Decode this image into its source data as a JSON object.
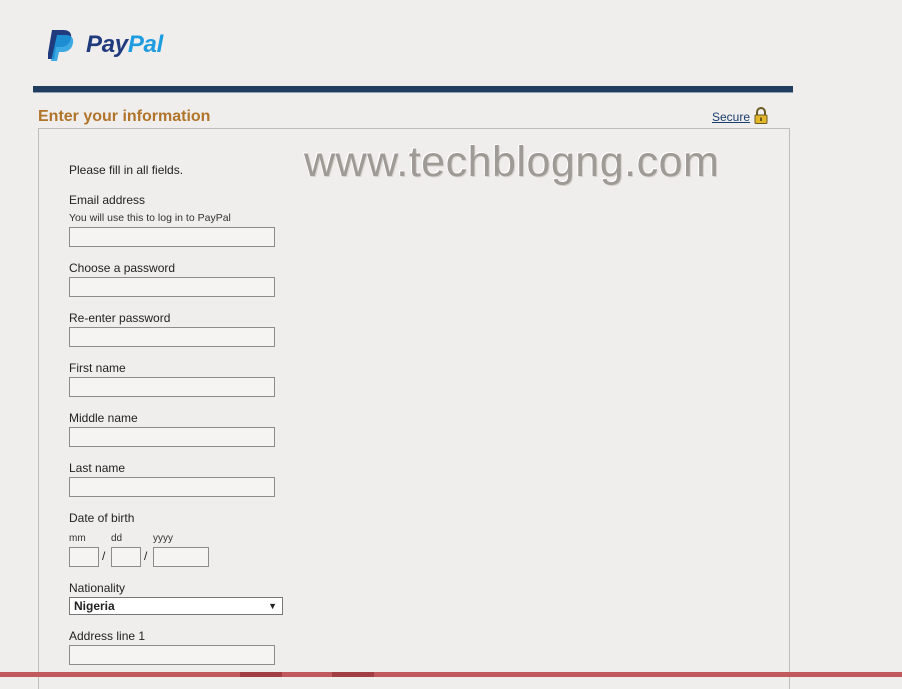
{
  "brand": {
    "logo_pay": "Pay",
    "logo_pal": "Pal",
    "colors": {
      "dark_blue": "#1f3a7d",
      "light_blue": "#1d9ce0"
    }
  },
  "header": {
    "title": "Enter your information",
    "secure_label": "Secure",
    "secure_icon": "lock-icon"
  },
  "watermark": "www.techblogng.com",
  "form": {
    "intro": "Please fill in all fields.",
    "email": {
      "label": "Email address",
      "hint": "You will use this to log in to PayPal",
      "value": ""
    },
    "password": {
      "label": "Choose a password",
      "value": ""
    },
    "password_confirm": {
      "label": "Re-enter password",
      "value": ""
    },
    "first_name": {
      "label": "First name",
      "value": ""
    },
    "middle_name": {
      "label": "Middle name",
      "value": ""
    },
    "last_name": {
      "label": "Last name",
      "value": ""
    },
    "dob": {
      "label": "Date of birth",
      "mm_label": "mm",
      "dd_label": "dd",
      "yyyy_label": "yyyy",
      "separator": "/"
    },
    "nationality": {
      "label": "Nationality",
      "selected": "Nigeria"
    },
    "address1": {
      "label": "Address line 1",
      "value": ""
    }
  }
}
